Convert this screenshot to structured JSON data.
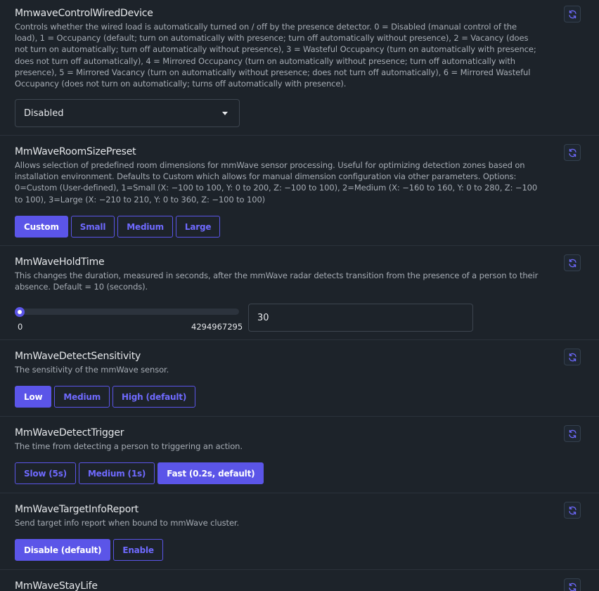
{
  "accent": "#5b55e8",
  "refresh_icon": "refresh-icon",
  "settings": [
    {
      "title": "MmwaveControlWiredDevice",
      "description": "Controls whether the wired load is automatically turned on / off by the presence detector. 0 = Disabled (manual control of the load), 1 = Occupancy (default; turn on automatically with presence; turn off automatically without presence), 2 = Vacancy (does not turn on automatically; turn off automatically without presence), 3 = Wasteful Occupancy (turn on automatically with presence; does not turn off automatically), 4 = Mirrored Occupancy (turn on automatically without presence; turn off automatically with presence), 5 = Mirrored Vacancy (turn on automatically without presence; does not turn off automatically), 6 = Mirrored Wasteful Occupancy (does not turn on automatically; turns off automatically with presence).",
      "control": "select",
      "selected": "Disabled"
    },
    {
      "title": "MmWaveRoomSizePreset",
      "description": "Allows selection of predefined room dimensions for mmWave sensor processing. Useful for optimizing detection zones based on installation environment. Defaults to Custom which allows for manual dimension configuration via other parameters. Options: 0=Custom (User-defined), 1=Small (X: −100 to 100, Y: 0 to 200, Z: −100 to 100), 2=Medium (X: −160 to 160, Y: 0 to 280, Z: −100 to 100), 3=Large (X: −210 to 210, Y: 0 to 360, Z: −100 to 100)",
      "options": [
        "Custom",
        "Small",
        "Medium",
        "Large"
      ],
      "selected": "Custom"
    },
    {
      "title": "MmWaveHoldTime",
      "description": "This changes the duration, measured in seconds, after the mmWave radar detects transition from the presence of a person to their absence. Default = 10 (seconds).",
      "slider_min": "0",
      "slider_max": "4294967295",
      "value": "30"
    },
    {
      "title": "MmWaveDetectSensitivity",
      "description": "The sensitivity of the mmWave sensor.",
      "options": [
        "Low",
        "Medium",
        "High (default)"
      ],
      "selected": "Low"
    },
    {
      "title": "MmWaveDetectTrigger",
      "description": "The time from detecting a person to triggering an action.",
      "options": [
        "Slow (5s)",
        "Medium (1s)",
        "Fast (0.2s, default)"
      ],
      "selected": "Fast (0.2s, default)"
    },
    {
      "title": "MmWaveTargetInfoReport",
      "description": "Send target info report when bound to mmWave cluster.",
      "options": [
        "Disable (default)",
        "Enable"
      ],
      "selected": "Disable (default)"
    },
    {
      "title": "MmWaveStayLife"
    }
  ]
}
